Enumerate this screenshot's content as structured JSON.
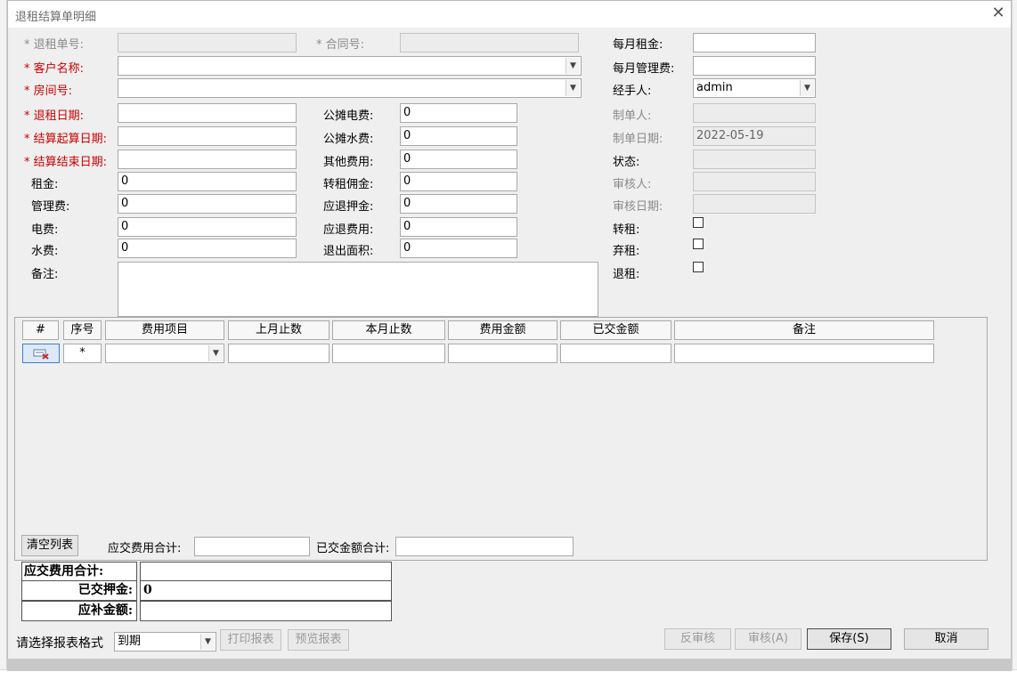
{
  "window": {
    "title": "退租结算单明细",
    "close_glyph": "✕"
  },
  "form": {
    "tuizu_danhao": {
      "label": "* 退租单号:",
      "value": ""
    },
    "hetong_hao": {
      "label": "* 合同号:",
      "value": ""
    },
    "kehu_mingcheng": {
      "label": "* 客户名称:",
      "value": ""
    },
    "fangjian_hao": {
      "label": "* 房间号:",
      "value": ""
    },
    "tuizu_riqi": {
      "label": "* 退租日期:",
      "value": ""
    },
    "jiesuan_qishi": {
      "label": "* 结算起算日期:",
      "value": ""
    },
    "jiesuan_jieshu": {
      "label": "* 结算结束日期:",
      "value": ""
    },
    "zujin": {
      "label": "租金:",
      "value": "0"
    },
    "guanlifei": {
      "label": "管理费:",
      "value": "0"
    },
    "dianfei": {
      "label": "电费:",
      "value": "0"
    },
    "shuifei": {
      "label": "水费:",
      "value": "0"
    },
    "beizhu": {
      "label": "备注:",
      "value": ""
    },
    "gongtan_dianfei": {
      "label": "公摊电费:",
      "value": "0"
    },
    "gongtan_shuifei": {
      "label": "公摊水费:",
      "value": "0"
    },
    "qita_feiyong": {
      "label": "其他费用:",
      "value": "0"
    },
    "zhuanzu_yongjin": {
      "label": "转租佣金:",
      "value": "0"
    },
    "yingtui_yajin": {
      "label": "应退押金:",
      "value": "0"
    },
    "yingtui_feiyong": {
      "label": "应退费用:",
      "value": "0"
    },
    "tuichu_mianji": {
      "label": "退出面积:",
      "value": "0"
    },
    "meiyue_zujin": {
      "label": "每月租金:",
      "value": ""
    },
    "meiyue_guanlifei": {
      "label": "每月管理费:",
      "value": ""
    },
    "jingshouren": {
      "label": "经手人:",
      "value": "admin"
    },
    "zhidanren": {
      "label": "制单人:",
      "value": ""
    },
    "zhidan_riqi": {
      "label": "制单日期:",
      "value": "2022-05-19"
    },
    "zhuangtai": {
      "label": "状态:",
      "value": ""
    },
    "shenheren": {
      "label": "审核人:",
      "value": ""
    },
    "shenhe_riqi": {
      "label": "审核日期:",
      "value": ""
    },
    "zhuanzu": {
      "label": "转租:",
      "checked": false
    },
    "qizu": {
      "label": "弃租:",
      "checked": false
    },
    "tuizu": {
      "label": "退租:",
      "checked": false
    }
  },
  "grid": {
    "columns": [
      "#",
      "序号",
      "费用项目",
      "上月止数",
      "本月止数",
      "费用金额",
      "已交金额",
      "备注"
    ],
    "rows": [
      {
        "seq": "*",
        "item": "",
        "last": "",
        "current": "",
        "amount": "",
        "paid": "",
        "note": ""
      }
    ],
    "clear_button": "清空列表",
    "yingjiao_total_label": "应交费用合计:",
    "yingjiao_total_value": "",
    "yijiao_total_label": "已交金额合计:",
    "yijiao_total_value": ""
  },
  "summary": [
    {
      "label": "应交费用合计:",
      "value": ""
    },
    {
      "label": "已交押金:",
      "value": "0"
    },
    {
      "label": "应补金额:",
      "value": ""
    }
  ],
  "footer": {
    "report_format_label": "请选择报表格式",
    "report_format_value": "到期",
    "print_button": "打印报表",
    "preview_button": "预览报表",
    "unaudit_button": "反审核",
    "audit_button": "审核(A)",
    "save_button": "保存(S)",
    "cancel_button": "取消"
  },
  "colors": {
    "required_label": "#cc0000",
    "disabled_label": "#8a8a8a",
    "dialog_bg": "#efefef"
  }
}
